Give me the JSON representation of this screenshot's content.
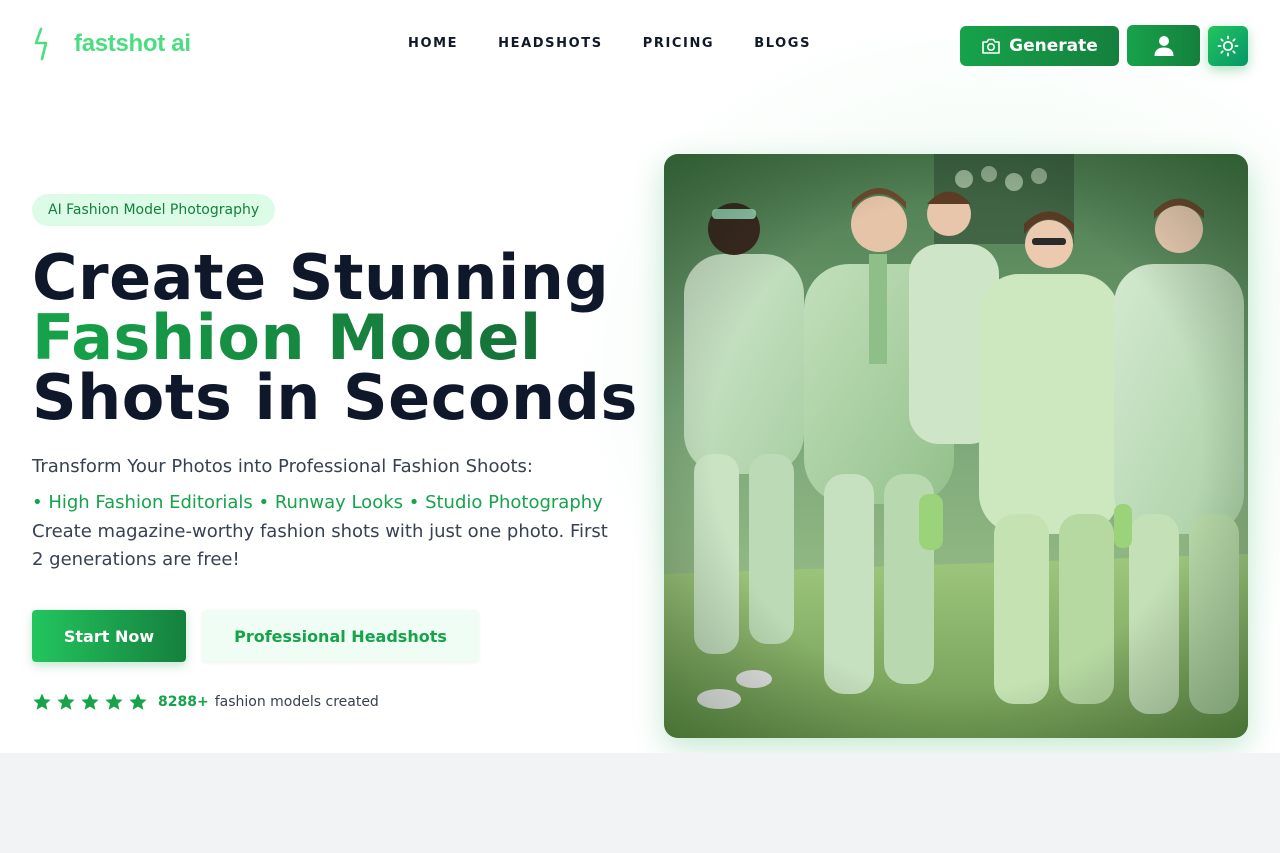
{
  "brand": {
    "name": "fastshot ai",
    "color": "#4ade80"
  },
  "nav": {
    "items": [
      {
        "label": "HOME"
      },
      {
        "label": "HEADSHOTS"
      },
      {
        "label": "PRICING"
      },
      {
        "label": "BLOGS"
      }
    ]
  },
  "actions": {
    "generate_label": "Generate",
    "generate_icon": "camera-icon",
    "user_icon": "user-icon",
    "theme_icon": "sun-icon"
  },
  "hero": {
    "badge": "AI Fashion Model Photography",
    "headline_line1": "Create Stunning",
    "headline_line2": "Fashion Model",
    "headline_line3": "Shots in Seconds",
    "subtitle": "Transform Your Photos into Professional Fashion Shoots:",
    "features": "• High Fashion Editorials • Runway Looks • Studio Photography",
    "description": "Create magazine-worthy fashion shots with just one photo. First 2 generations are free!",
    "primary_button": "Start Now",
    "secondary_button": "Professional Headshots",
    "rating": {
      "stars": 5,
      "count": "8288+",
      "text": "fashion models created"
    },
    "image_subject": "fashion-runway-photo"
  },
  "colors": {
    "accent": "#16a34a",
    "accent_dark": "#15803d",
    "badge_bg": "#dcfce7",
    "text_dark": "#0f172a"
  }
}
